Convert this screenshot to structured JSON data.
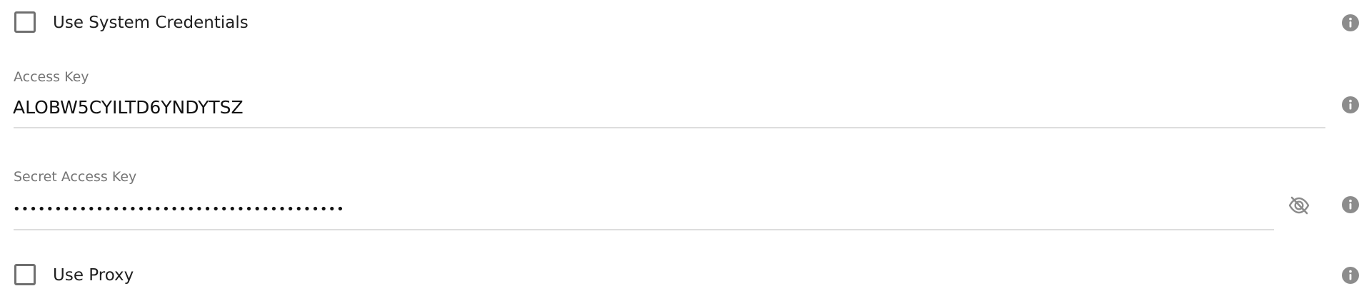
{
  "fields": {
    "use_system_credentials": {
      "label": "Use System Credentials",
      "checked": false,
      "info_icon": "info-icon"
    },
    "access_key": {
      "label": "Access Key",
      "value": "ALOBW5CYILTD6YNDYTSZ",
      "info_icon": "info-icon"
    },
    "secret_access_key": {
      "label": "Secret Access Key",
      "masked_value": "••••••••••••••••••••••••••••••••••••••••",
      "visibility_icon": "eye-off-icon",
      "info_icon": "info-icon"
    },
    "use_proxy": {
      "label": "Use Proxy",
      "checked": false,
      "info_icon": "info-icon"
    }
  }
}
